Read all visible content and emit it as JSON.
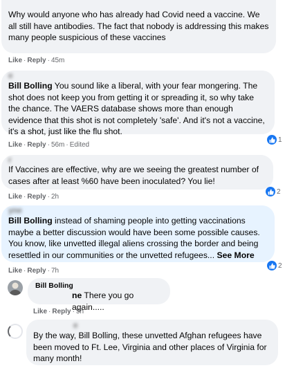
{
  "comments": [
    {
      "name": "",
      "text": "Why would anyone who has already had Covid need a vaccine. We all still have antibodies. The fact that nobody is addressing this makes many people suspicious of these vaccines",
      "like": "Like",
      "reply": "Reply",
      "time": "45m"
    },
    {
      "name": "e",
      "tag": "Bill Bolling",
      "text": " You sound like a liberal, with your fear mongering. The shot does not keep you from getting it or spreading it, so why take the chance. The VAERS database shows more than enough evidence that this shot is not completely 'safe'. And it's not a vaccine, it's a shot, just like the flu shot.",
      "like": "Like",
      "reply": "Reply",
      "time": "56m",
      "edited": "Edited",
      "reaction_count": "1"
    },
    {
      "name": "r",
      "text": "If Vaccines are effective, why are we seeing the greatest number of cases after at least %60 have been inoculated? You lie!",
      "like": "Like",
      "reply": "Reply",
      "time": "2h",
      "reaction_count": "2"
    },
    {
      "name": "yne",
      "tag": "Bill Bolling",
      "text": " instead of shaming people into getting vaccinations maybe a better discussion would have been some possible causes. You know, like unvetted illegal aliens crossing the border and being resettled in our communities or the unvetted refugees...",
      "see_more": "See More",
      "like": "Like",
      "reply": "Reply",
      "time": "7h",
      "reaction_count": "2"
    },
    {
      "name": "Bill Bolling",
      "tag": "ne",
      "text": " There you go again.....",
      "like": "Like",
      "reply": "Reply",
      "time": "5h"
    },
    {
      "name": "e",
      "text": "By the way, Bill Bolling, these unvetted Afghan refugees have been moved to Ft. Lee, Virginia and other places of Virginia for many month!"
    }
  ],
  "colors": {
    "bubble": "#f0f2f5",
    "bubble_highlight": "#e7f3ff",
    "meta_text": "#65676b",
    "reaction_blue": "#1877f2"
  },
  "icons": {
    "reaction": "like-thumb-icon",
    "avatar_reply": "user-avatar",
    "avatar_loading": "loading-avatar"
  }
}
